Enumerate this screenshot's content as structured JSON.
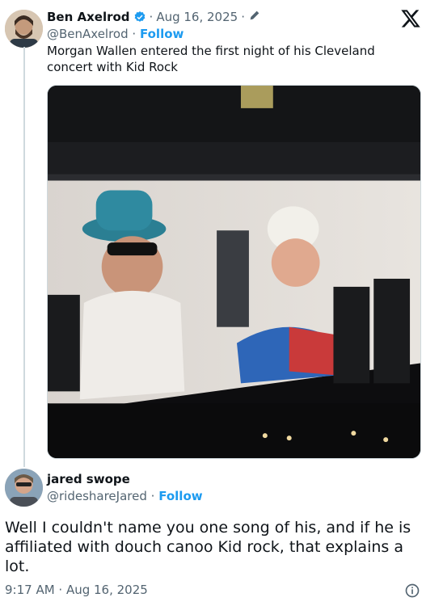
{
  "quoted_tweet": {
    "author_name": "Ben Axelrod",
    "date": "Aug 16, 2025",
    "separator": "·",
    "handle": "@BenAxelrod",
    "follow_label": "Follow",
    "text": "Morgan Wallen entered the first night of his Cleveland concert with Kid Rock",
    "verified_color": "#1d9bf0",
    "icons": [
      "verified-badge-icon",
      "pencil-icon",
      "x-logo-icon"
    ]
  },
  "reply_tweet": {
    "author_name": "jared swope",
    "handle": "@rideshareJared",
    "separator": "·",
    "follow_label": "Follow",
    "text": "Well I couldn't name you one song of his, and if he is affiliated with douch canoo Kid rock, that explains a lot.",
    "timestamp": "9:17 AM · Aug 16, 2025",
    "icons": [
      "info-icon"
    ]
  },
  "colors": {
    "link": "#1d9bf0",
    "secondary_text": "#536471",
    "primary_text": "#0f1419"
  }
}
